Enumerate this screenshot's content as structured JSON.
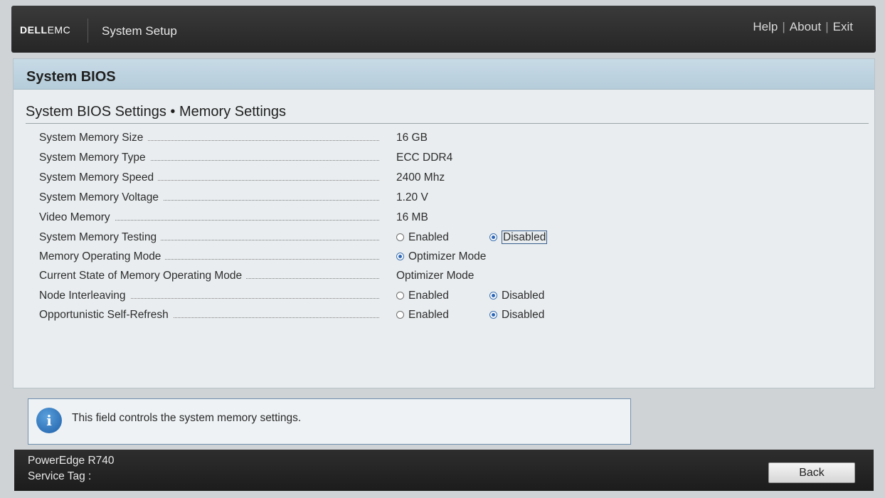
{
  "header": {
    "logo_main": "DELL",
    "logo_sub": "EMC",
    "app_title": "System Setup",
    "links": {
      "help": "Help",
      "about": "About",
      "exit": "Exit"
    },
    "separator": "|"
  },
  "panel": {
    "title": "System BIOS",
    "breadcrumb": "System BIOS Settings • Memory Settings"
  },
  "settings": {
    "memory_size": {
      "label": "System Memory Size",
      "value": "16 GB"
    },
    "memory_type": {
      "label": "System Memory Type",
      "value": "ECC DDR4"
    },
    "memory_speed": {
      "label": "System Memory Speed",
      "value": "2400 Mhz"
    },
    "memory_voltage": {
      "label": "System Memory Voltage",
      "value": "1.20 V"
    },
    "video_memory": {
      "label": "Video Memory",
      "value": "16 MB"
    },
    "memory_testing": {
      "label": "System Memory Testing",
      "options": [
        "Enabled",
        "Disabled"
      ],
      "selected": "Disabled"
    },
    "operating_mode": {
      "label": "Memory Operating Mode",
      "options": [
        "Optimizer Mode"
      ],
      "selected": "Optimizer Mode"
    },
    "current_state": {
      "label": "Current State of Memory Operating Mode",
      "value": "Optimizer Mode"
    },
    "node_interleaving": {
      "label": "Node Interleaving",
      "options": [
        "Enabled",
        "Disabled"
      ],
      "selected": "Disabled"
    },
    "self_refresh": {
      "label": "Opportunistic Self-Refresh",
      "options": [
        "Enabled",
        "Disabled"
      ],
      "selected": "Disabled"
    }
  },
  "help": {
    "icon": "info-icon",
    "icon_glyph": "i",
    "text": "This field controls the system memory settings."
  },
  "footer": {
    "model": "PowerEdge R740",
    "service_tag_label": "Service Tag :",
    "back_label": "Back"
  },
  "colors": {
    "header_bg": "#2b2b2b",
    "panel_header_bg": "#bdd2df",
    "panel_bg": "#e9edef",
    "radio_selected": "#2e67b7",
    "info_icon": "#1e5fa8"
  }
}
